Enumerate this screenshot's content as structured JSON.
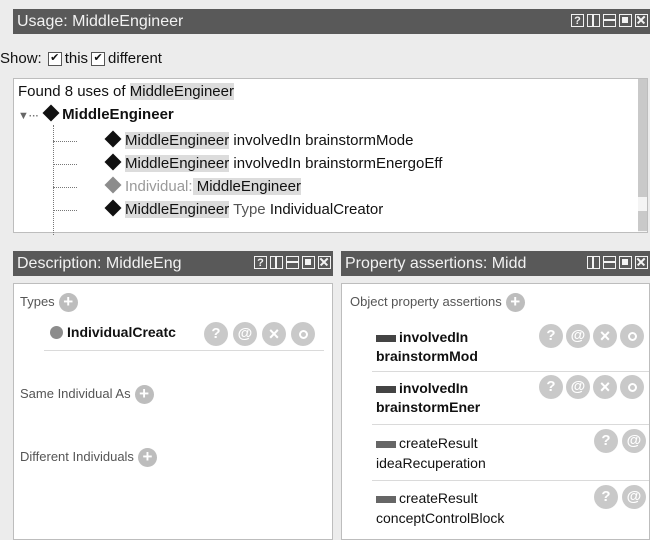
{
  "usage": {
    "title": "Usage: MiddleEngineer",
    "show_label": "Show:",
    "show_this": "this",
    "show_different": "different",
    "found_prefix": "Found 8 uses of ",
    "found_name": "MiddleEngineer",
    "root": "MiddleEngineer",
    "rows": [
      {
        "a": "MiddleEngineer",
        "b": " involvedIn brainstormMode"
      },
      {
        "a": "MiddleEngineer",
        "b": " involvedIn brainstormEnergoEff"
      },
      {
        "a": "Individual:",
        "b": " MiddleEngineer"
      },
      {
        "a": "MiddleEngineer",
        "b": " Type",
        "c": " IndividualCreator"
      }
    ]
  },
  "description": {
    "title": "Description: MiddleEng",
    "types_label": "Types",
    "type_value": "IndividualCreatc",
    "same_label": "Same Individual As",
    "different_label": "Different Individuals"
  },
  "properties": {
    "title": "Property assertions: Midd",
    "section_label": "Object property assertions",
    "items": [
      {
        "prop": "involvedIn",
        "value": "brainstormMod"
      },
      {
        "prop": "involvedIn",
        "value": "brainstormEner"
      },
      {
        "prop": "createResult",
        "value": "ideaRecuperation"
      },
      {
        "prop": "createResult",
        "value": "conceptControlBlock"
      }
    ]
  },
  "icons": {
    "help": "?",
    "annotate": "@",
    "delete": "×",
    "add": "+"
  },
  "colors": {
    "header_bg": "#595959",
    "highlight": "#dcdcdc",
    "button_gray": "#c9c9c9"
  }
}
